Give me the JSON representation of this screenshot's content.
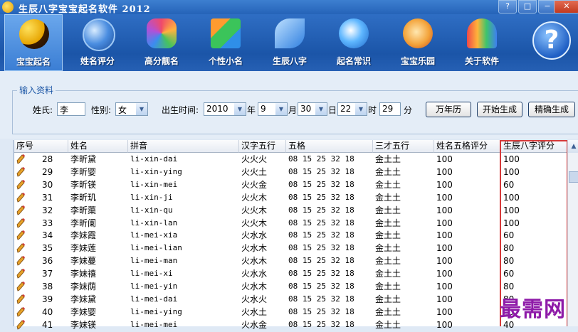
{
  "window": {
    "title": "生辰八字宝宝起名软件 2012",
    "controls": [
      "?",
      "□",
      "−",
      "✕"
    ]
  },
  "toolbar": [
    {
      "label": "宝宝起名",
      "icon": "yin-yang-icon",
      "active": true
    },
    {
      "label": "姓名评分",
      "icon": "globe-icon",
      "active": false
    },
    {
      "label": "高分靓名",
      "icon": "hexagon-cluster-icon",
      "active": false
    },
    {
      "label": "个性小名",
      "icon": "puzzle-blocks-icon",
      "active": false
    },
    {
      "label": "生辰八字",
      "icon": "blue-leaves-icon",
      "active": false
    },
    {
      "label": "起名常识",
      "icon": "info-bubble-icon",
      "active": false
    },
    {
      "label": "宝宝乐园",
      "icon": "cartoon-face-icon",
      "active": false
    },
    {
      "label": "关于软件",
      "icon": "butterfly-icon",
      "active": false
    },
    {
      "label": "",
      "icon": "help-question-icon",
      "active": false
    }
  ],
  "form": {
    "group_title": "输入资料",
    "surname_label": "姓氏:",
    "surname_value": "李",
    "gender_label": "性别:",
    "gender_value": "女",
    "birth_label": "出生时间:",
    "year": "2010",
    "year_unit": "年",
    "month": "9",
    "month_unit": "月",
    "day": "30",
    "day_unit": "日",
    "hour": "22",
    "hour_unit": "时",
    "minute": "29",
    "minute_unit": "分",
    "btn_calendar": "万年历",
    "btn_generate": "开始生成",
    "btn_precise": "精确生成"
  },
  "table": {
    "columns": [
      "序号",
      "姓名",
      "拼音",
      "汉字五行",
      "五格",
      "三才五行",
      "姓名五格评分",
      "生辰八字评分"
    ],
    "rows": [
      [
        "28",
        "李昕黛",
        "li-xin-dai",
        "火火火",
        "08 15 25 32 18",
        "金土土",
        "100",
        "100"
      ],
      [
        "29",
        "李昕婴",
        "li-xin-ying",
        "火火土",
        "08 15 25 32 18",
        "金土土",
        "100",
        "100"
      ],
      [
        "30",
        "李昕镁",
        "li-xin-mei",
        "火火金",
        "08 15 25 32 18",
        "金土土",
        "100",
        "60"
      ],
      [
        "31",
        "李昕玑",
        "li-xin-ji",
        "火火木",
        "08 15 25 32 18",
        "金土土",
        "100",
        "100"
      ],
      [
        "32",
        "李昕蕖",
        "li-xin-qu",
        "火火木",
        "08 15 25 32 18",
        "金土土",
        "100",
        "100"
      ],
      [
        "33",
        "李昕阑",
        "li-xin-lan",
        "火火木",
        "08 15 25 32 18",
        "金土土",
        "100",
        "100"
      ],
      [
        "34",
        "李妹霞",
        "li-mei-xia",
        "火水水",
        "08 15 25 32 18",
        "金土土",
        "100",
        "60"
      ],
      [
        "35",
        "李妹莲",
        "li-mei-lian",
        "火水木",
        "08 15 25 32 18",
        "金土土",
        "100",
        "80"
      ],
      [
        "36",
        "李妹蔓",
        "li-mei-man",
        "火水木",
        "08 15 25 32 18",
        "金土土",
        "100",
        "80"
      ],
      [
        "37",
        "李妹禧",
        "li-mei-xi",
        "火水水",
        "08 15 25 32 18",
        "金土土",
        "100",
        "60"
      ],
      [
        "38",
        "李妹荫",
        "li-mei-yin",
        "火水木",
        "08 15 25 32 18",
        "金土土",
        "100",
        "80"
      ],
      [
        "39",
        "李妹黛",
        "li-mei-dai",
        "火水火",
        "08 15 25 32 18",
        "金土土",
        "100",
        "80"
      ],
      [
        "40",
        "李妹婴",
        "li-mei-ying",
        "火水土",
        "08 15 25 32 18",
        "金土土",
        "100",
        "80"
      ],
      [
        "41",
        "李妹镁",
        "li-mei-mei",
        "火水金",
        "08 15 25 32 18",
        "金土土",
        "100",
        "40"
      ]
    ]
  },
  "watermark": "最需网",
  "colors": {
    "toolbar": "#1b55a8",
    "highlight_box": "#d63a3a",
    "watermark": "#8e1aa8"
  }
}
